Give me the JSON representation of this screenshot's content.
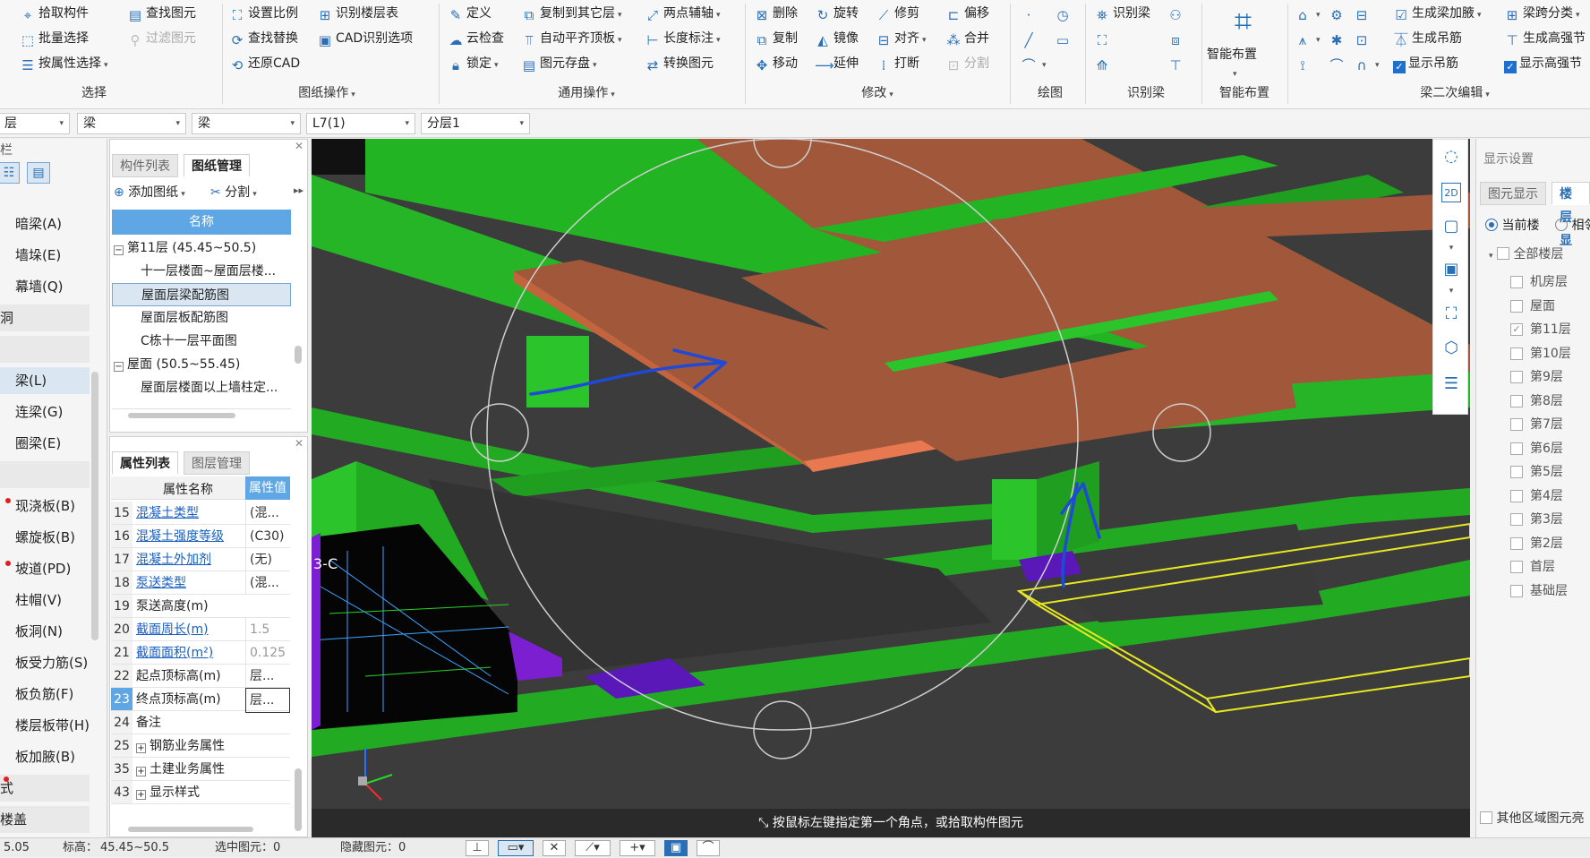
{
  "ribbon": {
    "select": {
      "pick": "拾取构件",
      "batch": "批量选择",
      "by_attr": "按属性选择",
      "find": "查找图元",
      "filter": "过滤图元",
      "group": "选择"
    },
    "drawing_ops": {
      "set_scale": "设置比例",
      "identify_floor_table": "识别楼层表",
      "find_replace": "查找替换",
      "cad_options": "CAD识别选项",
      "restore_cad": "还原CAD",
      "group": "图纸操作"
    },
    "common_ops": {
      "define": "定义",
      "copy_to_other": "复制到其它层",
      "two_point_axis": "两点辅轴",
      "cloud_check": "云检查",
      "auto_flat_top": "自动平齐顶板",
      "length_dim": "长度标注",
      "lock": "锁定",
      "save_elements": "图元存盘",
      "convert_elements": "转换图元",
      "group": "通用操作"
    },
    "modify": {
      "delete": "删除",
      "rotate": "旋转",
      "trim": "修剪",
      "offset": "偏移",
      "copy": "复制",
      "mirror": "镜像",
      "align": "对齐",
      "merge": "合并",
      "move": "移动",
      "extend": "延伸",
      "break": "打断",
      "split": "分割",
      "group": "修改"
    },
    "draw": {
      "group": "绘图"
    },
    "identify": {
      "identify_beam": "识别梁",
      "group": "识别梁"
    },
    "smart": {
      "smart_layout": "智能布置",
      "group": "智能布置"
    },
    "beam_edit": {
      "gen_haunch": "生成梁加腋",
      "span_class": "梁跨分类",
      "gen_hanger": "生成吊筋",
      "gen_stirrup": "生成高强节",
      "show_hanger": "显示吊筋",
      "show_stirrup": "显示高强节",
      "group": "梁二次编辑"
    }
  },
  "filters": [
    "层",
    "梁",
    "梁",
    "L7(1)",
    "分层1"
  ],
  "nav": {
    "title": "栏",
    "items": [
      "暗梁(A)",
      "墙垛(E)",
      "幕墙(Q)",
      "洞",
      "梁(L)",
      "连梁(G)",
      "圈梁(E)",
      "现浇板(B)",
      "螺旋板(B)",
      "坡道(PD)",
      "柱帽(V)",
      "板洞(N)",
      "板受力筋(S)",
      "板负筋(F)",
      "楼层板带(H)",
      "板加腋(B)",
      "式",
      "楼盖"
    ]
  },
  "drawing_panel": {
    "tab_components": "构件列表",
    "tab_drawings": "图纸管理",
    "add_drawing": "添加图纸",
    "split": "分割",
    "col_name": "名称",
    "tree": [
      {
        "label": "第11层 (45.45~50.5)",
        "level": 0
      },
      {
        "label": "十一层楼面~屋面层楼...",
        "level": 1
      },
      {
        "label": "屋面层梁配筋图",
        "level": 1
      },
      {
        "label": "屋面层板配筋图",
        "level": 1
      },
      {
        "label": "C栋十一层平面图",
        "level": 1
      },
      {
        "label": "屋面 (50.5~55.45)",
        "level": 0
      },
      {
        "label": "屋面层楼面以上墙柱定...",
        "level": 1
      }
    ]
  },
  "prop_panel": {
    "tab_props": "属性列表",
    "tab_layers": "图层管理",
    "col_name": "属性名称",
    "col_value": "属性值",
    "rows": [
      {
        "num": "15",
        "name": "混凝土类型",
        "value": "(混...",
        "link": true
      },
      {
        "num": "16",
        "name": "混凝土强度等级",
        "value": "(C30)",
        "link": true
      },
      {
        "num": "17",
        "name": "混凝土外加剂",
        "value": "(无)",
        "link": true
      },
      {
        "num": "18",
        "name": "泵送类型",
        "value": "(混...",
        "link": true
      },
      {
        "num": "19",
        "name": "泵送高度(m)",
        "value": "",
        "link": false
      },
      {
        "num": "20",
        "name": "截面周长(m)",
        "value": "1.5",
        "link": true
      },
      {
        "num": "21",
        "name": "截面面积(m²)",
        "value": "0.125",
        "link": true
      },
      {
        "num": "22",
        "name": "起点顶标高(m)",
        "value": "层...",
        "link": false
      },
      {
        "num": "23",
        "name": "终点顶标高(m)",
        "value": "层...",
        "link": false
      },
      {
        "num": "24",
        "name": "备注",
        "value": "",
        "link": false
      },
      {
        "num": "25",
        "name": "钢筋业务属性",
        "value": "",
        "link": false
      },
      {
        "num": "35",
        "name": "土建业务属性",
        "value": "",
        "link": false
      },
      {
        "num": "43",
        "name": "显示样式",
        "value": "",
        "link": false
      }
    ]
  },
  "viewport": {
    "hint": "按鼠标左键指定第一个角点，或拾取构件图元",
    "cad_label": "3-C",
    "colors": {
      "beam": "#2eb82e",
      "slab": "#a0573a",
      "bg": "#3c3c3c",
      "selection": "#e8e820"
    }
  },
  "display_settings": {
    "title": "显示设置",
    "tab_elements": "图元显示",
    "tab_floors": "楼层显",
    "radio_current": "当前楼",
    "radio_related": "相邻",
    "all_floors": "全部楼层",
    "floors": [
      {
        "name": "机房层",
        "checked": false
      },
      {
        "name": "屋面",
        "checked": false
      },
      {
        "name": "第11层",
        "checked": true
      },
      {
        "name": "第10层",
        "checked": false
      },
      {
        "name": "第9层",
        "checked": false
      },
      {
        "name": "第8层",
        "checked": false
      },
      {
        "name": "第7层",
        "checked": false
      },
      {
        "name": "第6层",
        "checked": false
      },
      {
        "name": "第5层",
        "checked": false
      },
      {
        "name": "第4层",
        "checked": false
      },
      {
        "name": "第3层",
        "checked": false
      },
      {
        "name": "第2层",
        "checked": false
      },
      {
        "name": "首层",
        "checked": false
      },
      {
        "name": "基础层",
        "checked": false
      }
    ],
    "other_region": "其他区域图元亮"
  },
  "status": {
    "coord": "5.05",
    "elev_label": "标高：",
    "elev_value": "45.45~50.5",
    "selected": "选中图元：0",
    "hidden": "隐藏图元：0"
  }
}
